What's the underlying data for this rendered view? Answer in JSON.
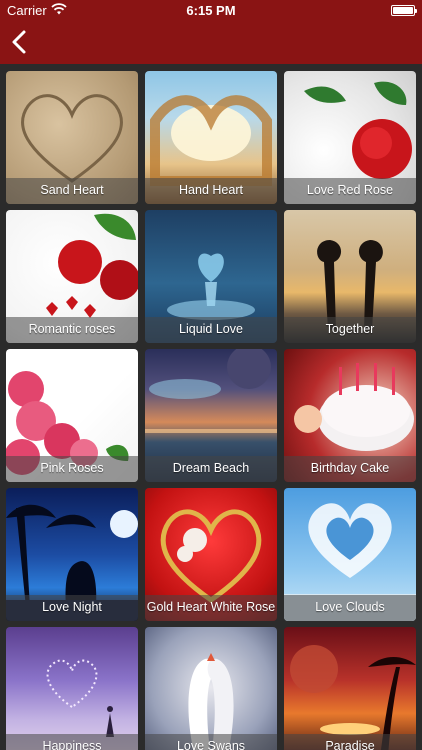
{
  "status_bar": {
    "carrier": "Carrier",
    "time": "6:15 PM"
  },
  "nav": {
    "back_icon": "chevron-left-icon",
    "bar_color": "#8a1414"
  },
  "gallery": {
    "items": [
      {
        "label": "Sand Heart"
      },
      {
        "label": "Hand Heart"
      },
      {
        "label": "Love Red Rose"
      },
      {
        "label": "Romantic roses"
      },
      {
        "label": "Liquid Love"
      },
      {
        "label": "Together"
      },
      {
        "label": "Pink Roses"
      },
      {
        "label": "Dream Beach"
      },
      {
        "label": "Birthday Cake"
      },
      {
        "label": "Love Night"
      },
      {
        "label": "Gold Heart White Rose"
      },
      {
        "label": "Love Clouds"
      },
      {
        "label": "Happiness"
      },
      {
        "label": "Love Swans"
      },
      {
        "label": "Paradise"
      }
    ]
  }
}
